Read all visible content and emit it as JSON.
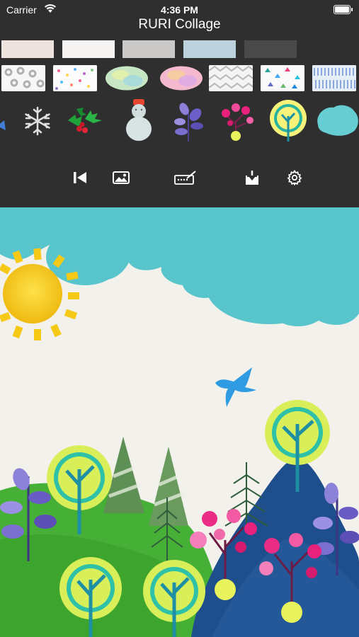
{
  "status": {
    "carrier": "Carrier",
    "time": "4:36 PM"
  },
  "app": {
    "title": "RURI Collage"
  },
  "colors": {
    "panel": "#2f2f2f",
    "sky_teal": "#56c6cd",
    "sun_yellow": "#f5c915",
    "bird_blue": "#2e9be3",
    "grass_green": "#45b035",
    "mountain_navy": "#1f4e8c"
  },
  "palette": {
    "swatches": [
      "#efe3df",
      "#f6f4f2",
      "#cbc8c8",
      "#bcd2dc",
      "#4a4a4a"
    ]
  },
  "papers": [
    "gray-circles-paper",
    "confetti-dots-paper",
    "pastel-green-blob-paper",
    "pink-scribble-blob-paper",
    "gray-chevron-paper",
    "triangle-confetti-paper",
    "blue-stripe-paper"
  ],
  "stickers": [
    "blue-fragment-sticker",
    "snowflake-sticker",
    "holly-sticker",
    "snowman-sticker",
    "purple-leaf-branch-sticker",
    "pink-berry-tree-sticker",
    "teal-dot-tree-sticker",
    "teal-cloud-sticker"
  ],
  "toolbar": {
    "icons": [
      "skip-back-icon",
      "image-icon",
      "signature-icon",
      "download-icon",
      "gear-icon"
    ]
  }
}
